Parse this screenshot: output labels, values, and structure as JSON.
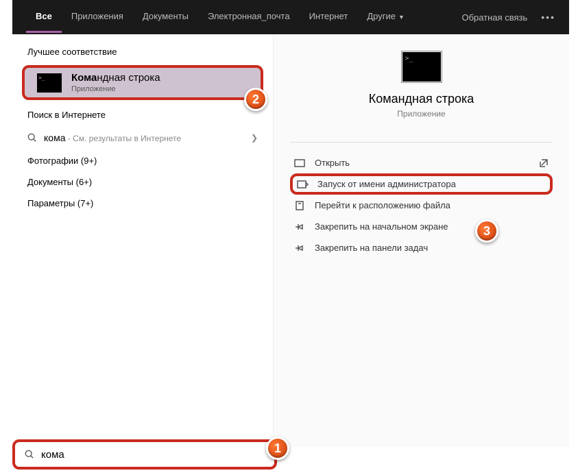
{
  "header": {
    "tabs": [
      "Все",
      "Приложения",
      "Документы",
      "Электронная_почта",
      "Интернет"
    ],
    "more_label": "Другие",
    "feedback": "Обратная связь"
  },
  "left": {
    "best_match_header": "Лучшее соответствие",
    "best_match_title_bold": "Кома",
    "best_match_title_rest": "ндная строка",
    "best_match_subtitle": "Приложение",
    "web_header": "Поиск в Интернете",
    "web_query": "кома",
    "web_sub": " - См. результаты в Интернете",
    "categories": [
      "Фотографии (9+)",
      "Документы (6+)",
      "Параметры (7+)"
    ]
  },
  "right": {
    "title": "Командная строка",
    "subtitle": "Приложение",
    "actions": [
      "Открыть",
      "Запуск от имени администратора",
      "Перейти к расположению файла",
      "Закрепить на начальном экране",
      "Закрепить на панели задач"
    ]
  },
  "search": {
    "value": "кома"
  },
  "badges": {
    "one": "1",
    "two": "2",
    "three": "3"
  }
}
